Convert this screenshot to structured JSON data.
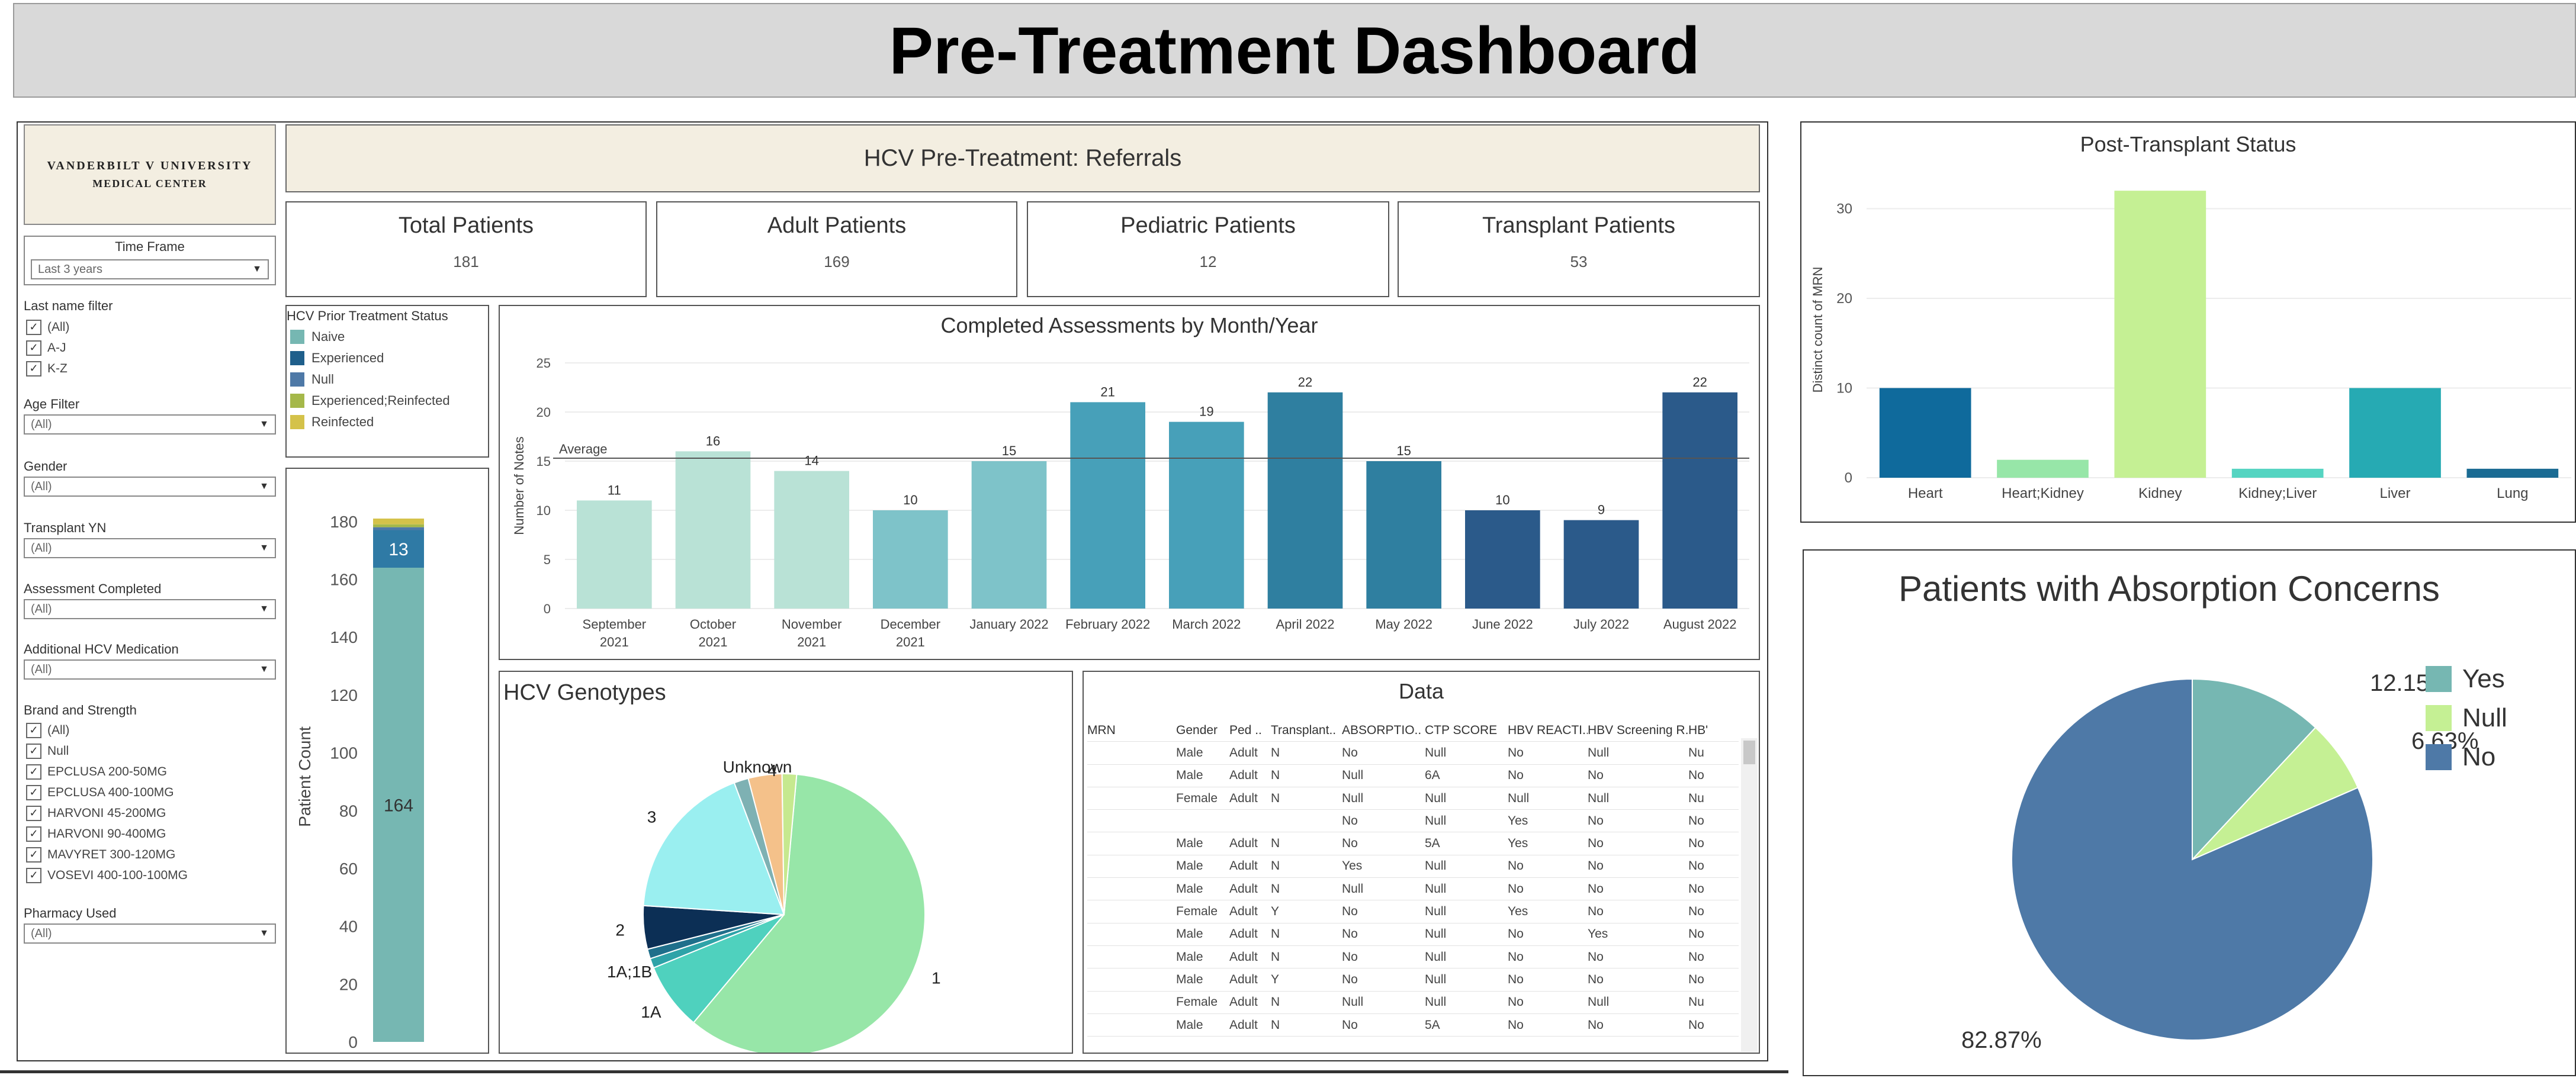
{
  "page_title": "Pre-Treatment Dashboard",
  "logo": {
    "line1": "VANDERBILT V UNIVERSITY",
    "line2": "MEDICAL CENTER"
  },
  "filters": {
    "time_frame": {
      "label": "Time Frame",
      "value": "Last 3 years"
    },
    "last_name": {
      "label": "Last name filter",
      "options": [
        "(All)",
        "A-J",
        "K-Z"
      ]
    },
    "age": {
      "label": "Age Filter",
      "value": "(All)"
    },
    "gender": {
      "label": "Gender",
      "value": "(All)"
    },
    "transplant_yn": {
      "label": "Transplant YN",
      "value": "(All)"
    },
    "assessment_completed": {
      "label": "Assessment Completed",
      "value": "(All)"
    },
    "additional_med": {
      "label": "Additional HCV Medication",
      "value": "(All)"
    },
    "brand_strength": {
      "label": "Brand and Strength",
      "options": [
        "(All)",
        "Null",
        "EPCLUSA 200-50MG",
        "EPCLUSA 400-100MG",
        "HARVONI 45-200MG",
        "HARVONI 90-400MG",
        "MAVYRET 300-120MG",
        "VOSEVI 400-100-100MG"
      ]
    },
    "pharmacy": {
      "label": "Pharmacy Used",
      "value": "(All)"
    }
  },
  "header": {
    "title": "HCV Pre-Treatment: Referrals"
  },
  "kpis": [
    {
      "title": "Total Patients",
      "value": "181"
    },
    {
      "title": "Adult Patients",
      "value": "169"
    },
    {
      "title": "Pediatric Patients",
      "value": "12"
    },
    {
      "title": "Transplant Patients",
      "value": "53"
    }
  ],
  "legend": {
    "title": "HCV Prior Treatment Status",
    "items": [
      {
        "label": "Naive",
        "color": "#76b7b2"
      },
      {
        "label": "Experienced",
        "color": "#1f5f8b"
      },
      {
        "label": "Null",
        "color": "#4e79a7"
      },
      {
        "label": "Experienced;Reinfected",
        "color": "#a5b84a"
      },
      {
        "label": "Reinfected",
        "color": "#d4c24a"
      }
    ]
  },
  "chart_data": [
    {
      "type": "bar",
      "title": "Completed Assessments by Month/Year",
      "ylabel": "Number of Notes",
      "categories": [
        "September 2021",
        "October 2021",
        "November 2021",
        "December 2021",
        "January 2022",
        "February 2022",
        "March 2022",
        "April 2022",
        "May 2022",
        "June 2022",
        "July 2022",
        "August 2022"
      ],
      "values": [
        11,
        16,
        14,
        10,
        15,
        21,
        19,
        22,
        15,
        10,
        9,
        22
      ],
      "colors": [
        "#b9e2d6",
        "#b9e2d6",
        "#b9e2d6",
        "#7ec3c9",
        "#7ec3c9",
        "#47a0b9",
        "#47a0b9",
        "#2f7fa0",
        "#2f7fa0",
        "#2b5a8a",
        "#2b5a8a",
        "#2b5a8a"
      ],
      "ylim": [
        0,
        25
      ],
      "yticks": [
        0,
        5,
        10,
        15,
        20,
        25
      ],
      "reference_line": {
        "label": "Average",
        "value": 15.3
      },
      "grid": true
    },
    {
      "type": "bar",
      "title": "",
      "ylabel": "Patient Count",
      "stacked": true,
      "series": [
        {
          "name": "Naive",
          "value": 164,
          "color": "#76b7b2"
        },
        {
          "name": "Experienced",
          "value": 13,
          "color": "#2f7aa5"
        },
        {
          "name": "Null",
          "value": 1,
          "color": "#4e79a7"
        },
        {
          "name": "Experienced;Reinfected",
          "value": 1,
          "color": "#a5b84a"
        },
        {
          "name": "Reinfected",
          "value": 2,
          "color": "#d4c24a"
        }
      ],
      "ylim": [
        0,
        190
      ],
      "yticks": [
        0,
        20,
        40,
        60,
        80,
        100,
        120,
        140,
        160,
        180
      ]
    },
    {
      "type": "pie",
      "title": "HCV Genotypes",
      "slices": [
        {
          "label": "1",
          "value": 108,
          "color": "#97e6a8"
        },
        {
          "label": "1A",
          "value": 14,
          "color": "#4fd1be"
        },
        {
          "label": "1A;1B",
          "value": 2,
          "color": "#2ea3a8"
        },
        {
          "label": "",
          "value": 2,
          "color": "#1f6f8b"
        },
        {
          "label": "2",
          "value": 9,
          "color": "#0c2f55"
        },
        {
          "label": "3",
          "value": 33,
          "color": "#9aeff0"
        },
        {
          "label": "4",
          "value": 3,
          "color": "#7eb1b3"
        },
        {
          "label": "Unknown",
          "value": 7,
          "color": "#f4c18a"
        },
        {
          "label": "",
          "value": 3,
          "color": "#c6e98f"
        }
      ]
    },
    {
      "type": "bar",
      "title": "Post-Transplant Status",
      "ylabel": "Distinct count of MRN",
      "categories": [
        "Heart",
        "Heart;Kidney",
        "Kidney",
        "Kidney;Liver",
        "Liver",
        "Lung"
      ],
      "values": [
        10,
        2,
        32,
        1,
        10,
        1
      ],
      "colors": [
        "#0f6a9c",
        "#97e6a8",
        "#c5f094",
        "#55d4c1",
        "#26aab3",
        "#1a6b93"
      ],
      "ylim": [
        0,
        33
      ],
      "yticks": [
        0,
        10,
        20,
        30
      ]
    },
    {
      "type": "pie",
      "title": "Patients with Absorption Concerns",
      "slices": [
        {
          "label": "Yes",
          "value": 12.15,
          "display": "12.15%",
          "color": "#76b7b2"
        },
        {
          "label": "Null",
          "value": 6.63,
          "display": "6.63%",
          "color": "#c5f094"
        },
        {
          "label": "No",
          "value": 82.87,
          "display": "82.87%",
          "color": "#4e79a7"
        }
      ],
      "legend_position": "right"
    }
  ],
  "data_table": {
    "title": "Data",
    "columns": [
      "MRN",
      "Gender",
      "Ped ..",
      "Transplant..",
      "ABSORPTIO..",
      "CTP SCORE",
      "HBV REACTI..",
      "HBV Screening R..",
      "HB'"
    ],
    "rows": [
      [
        "",
        "Male",
        "Adult",
        "N",
        "No",
        "Null",
        "No",
        "Null",
        "Nu"
      ],
      [
        "",
        "Male",
        "Adult",
        "N",
        "Null",
        "6A",
        "No",
        "No",
        "No"
      ],
      [
        "",
        "Female",
        "Adult",
        "N",
        "Null",
        "Null",
        "Null",
        "Null",
        "Nu"
      ],
      [
        "",
        "",
        "",
        "",
        "No",
        "Null",
        "Yes",
        "No",
        "No"
      ],
      [
        "",
        "Male",
        "Adult",
        "N",
        "No",
        "5A",
        "Yes",
        "No",
        "No"
      ],
      [
        "",
        "Male",
        "Adult",
        "N",
        "Yes",
        "Null",
        "No",
        "No",
        "No"
      ],
      [
        "",
        "Male",
        "Adult",
        "N",
        "Null",
        "Null",
        "No",
        "No",
        "No"
      ],
      [
        "",
        "Female",
        "Adult",
        "Y",
        "No",
        "Null",
        "Yes",
        "No",
        "No"
      ],
      [
        "",
        "Male",
        "Adult",
        "N",
        "No",
        "Null",
        "No",
        "Yes",
        "No"
      ],
      [
        "",
        "Male",
        "Adult",
        "N",
        "No",
        "Null",
        "No",
        "No",
        "No"
      ],
      [
        "",
        "Male",
        "Adult",
        "Y",
        "No",
        "Null",
        "No",
        "No",
        "No"
      ],
      [
        "",
        "Female",
        "Adult",
        "N",
        "Null",
        "Null",
        "No",
        "Null",
        "Nu"
      ],
      [
        "",
        "Male",
        "Adult",
        "N",
        "No",
        "5A",
        "No",
        "No",
        "No"
      ]
    ]
  }
}
